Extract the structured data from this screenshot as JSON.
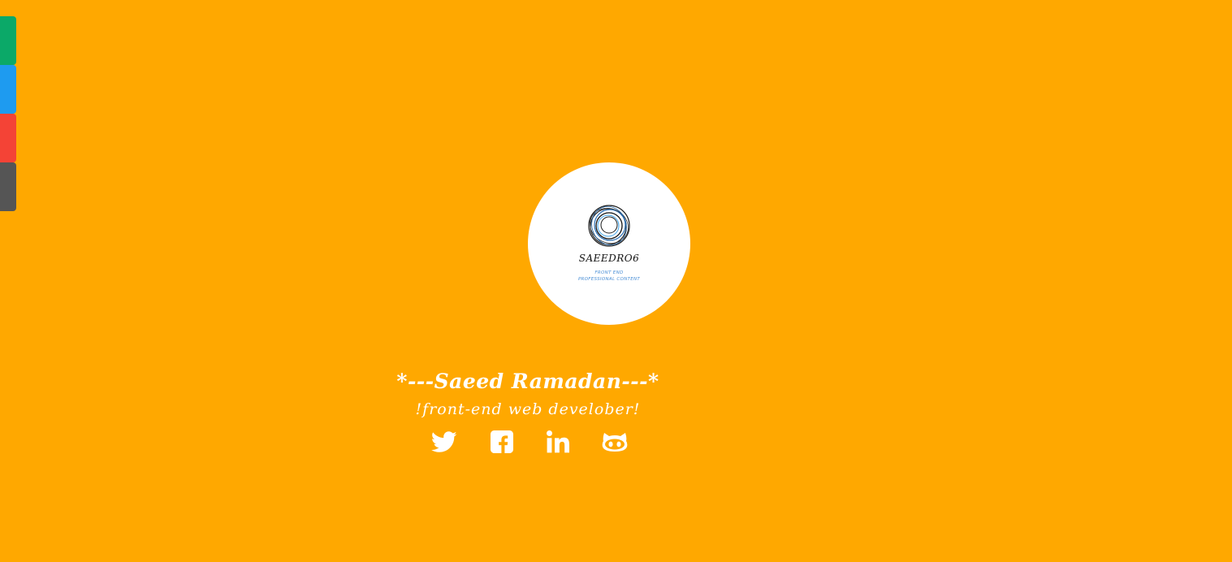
{
  "side_tabs": [
    {
      "name": "side-tab-green",
      "color": "#0BA968"
    },
    {
      "name": "side-tab-blue",
      "color": "#1E9BF0"
    },
    {
      "name": "side-tab-red",
      "color": "#F44336"
    },
    {
      "name": "side-tab-gray",
      "color": "#555555"
    }
  ],
  "logo": {
    "title": "SAEEDRO6",
    "sub_line1": "FRONT END",
    "sub_line2": "PROFESSIONAL CONTENT"
  },
  "profile": {
    "name": "*---Saeed Ramadan---*",
    "role": "!front-end web develober!"
  },
  "social_icons": [
    "twitter-icon",
    "facebook-icon",
    "linkedin-icon",
    "github-icon"
  ],
  "colors": {
    "background": "#FFA800",
    "text": "#FFFFFF"
  }
}
